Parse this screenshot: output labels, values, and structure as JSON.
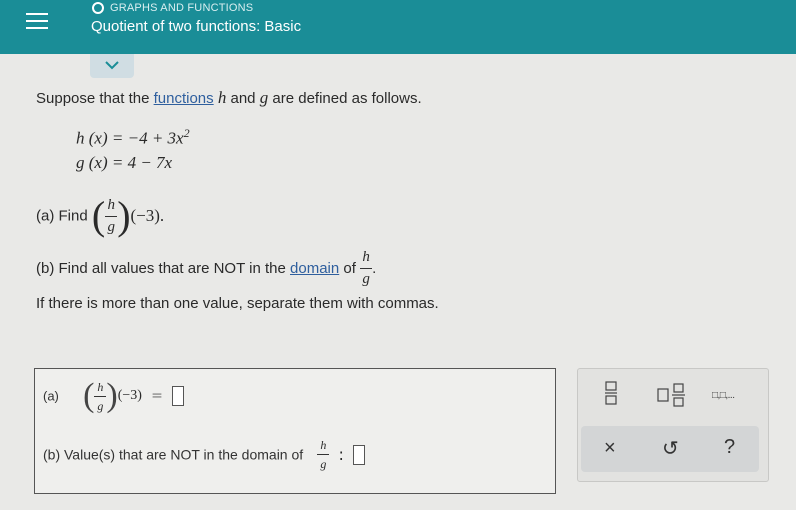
{
  "header": {
    "topic": "GRAPHS AND FUNCTIONS",
    "title": "Quotient of two functions: Basic"
  },
  "problem": {
    "intro_before": "Suppose that the",
    "functions_link": "functions",
    "var_h": "h",
    "and": "and",
    "var_g": "g",
    "intro_after": "are defined as follows.",
    "h_def_lhs": "h (x) = ",
    "h_def_rhs": "−4 + 3x",
    "h_def_exp": "2",
    "g_def": "g (x) = 4 − 7x",
    "part_a_label": "(a) Find",
    "frac_num": "h",
    "frac_den": "g",
    "part_a_arg": "(−3).",
    "part_b_before": "(b) Find all values that are NOT in the",
    "domain_link": "domain",
    "part_b_of": "of",
    "part_b_period": ".",
    "instruction": "If there is more than one value, separate them with commas."
  },
  "answer": {
    "a_label": "(a)",
    "a_arg": "(−3)",
    "a_eq": "=",
    "b_label": "(b)  Value(s) that are NOT in the domain of",
    "b_colon": ":"
  },
  "keypad": {
    "more_label": "□,□,...",
    "clear_label": "×",
    "undo_label": "↺",
    "help_label": "?"
  },
  "colors": {
    "header": "#1a8d97",
    "link": "#2f5f9e"
  }
}
